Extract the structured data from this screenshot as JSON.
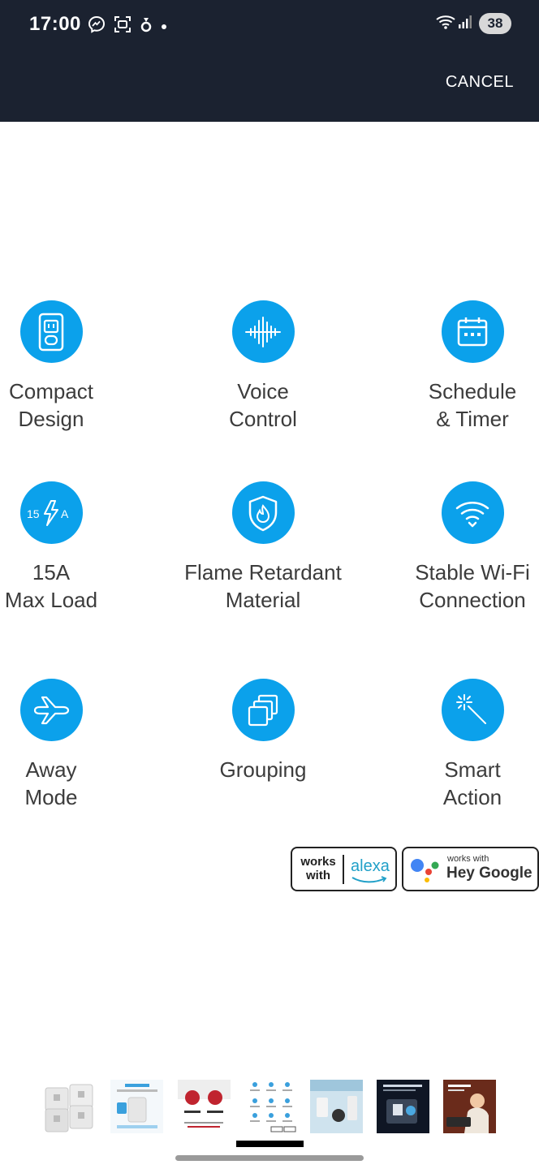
{
  "status_bar": {
    "time": "17:00",
    "battery": "38"
  },
  "header": {
    "cancel_label": "CANCEL"
  },
  "features": [
    {
      "label": "Compact\nDesign",
      "icon": "compact-design-icon"
    },
    {
      "label": "Voice\nControl",
      "icon": "voice-control-icon"
    },
    {
      "label": "Schedule\n& Timer",
      "icon": "schedule-timer-icon"
    },
    {
      "label": "15A\nMax Load",
      "icon": "max-load-icon"
    },
    {
      "label": "Flame Retardant\nMaterial",
      "icon": "flame-retardant-icon"
    },
    {
      "label": "Stable Wi-Fi\nConnection",
      "icon": "wifi-icon"
    },
    {
      "label": "Away\nMode",
      "icon": "airplane-icon"
    },
    {
      "label": "Grouping",
      "icon": "grouping-icon"
    },
    {
      "label": "Smart\nAction",
      "icon": "smart-action-icon"
    }
  ],
  "icon_text": {
    "max_load": "15",
    "max_load_unit": "A"
  },
  "badges": {
    "alexa": {
      "line1": "works",
      "line2": "with",
      "brand": "alexa"
    },
    "google": {
      "small": "works with",
      "big": "Hey Google"
    }
  },
  "colors": {
    "accent": "#0ba1eb",
    "header_bg": "#1b2230",
    "text": "#3c3c3c"
  }
}
